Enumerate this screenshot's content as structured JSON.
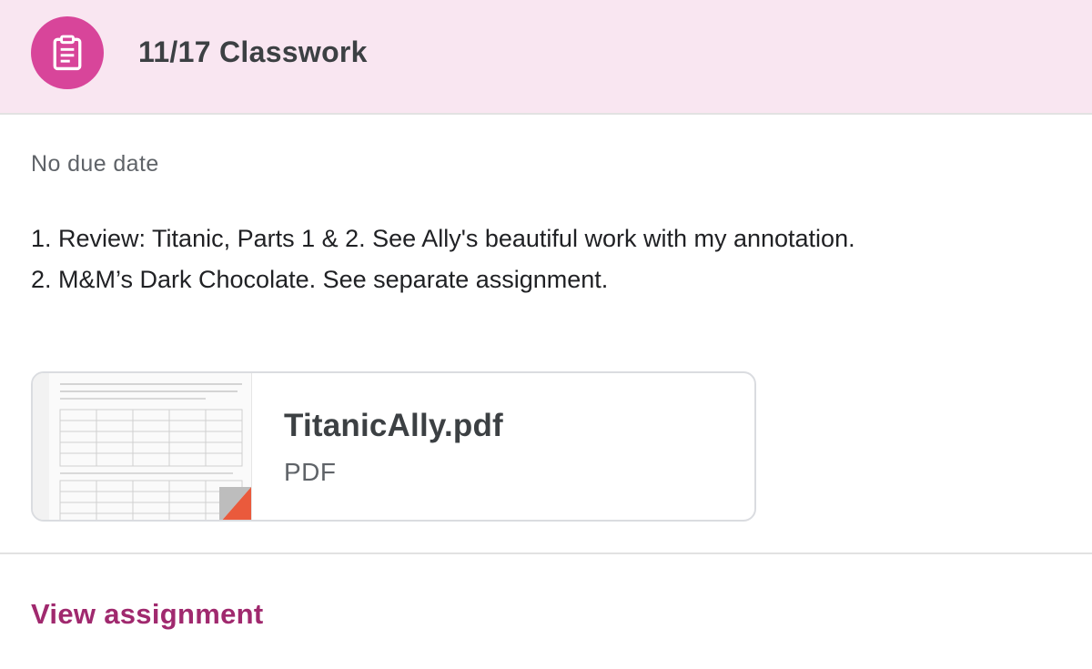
{
  "header": {
    "title": "11/17 Classwork",
    "icon": "assignment-icon",
    "accent_color": "#d8459a",
    "background_color": "#f9e6f1"
  },
  "due_date": "No due date",
  "description": {
    "lines": [
      "1. Review: Titanic, Parts 1 & 2. See Ally's beautiful work with my annotation.",
      "2. M&M’s Dark Chocolate. See separate assignment."
    ]
  },
  "attachment": {
    "name": "TitanicAlly.pdf",
    "type": "PDF",
    "thumbnail_icon": "pdf-file-thumbnail",
    "badge_color": "#ea5a3c"
  },
  "footer": {
    "view_label": "View assignment",
    "link_color": "#a0296e"
  }
}
